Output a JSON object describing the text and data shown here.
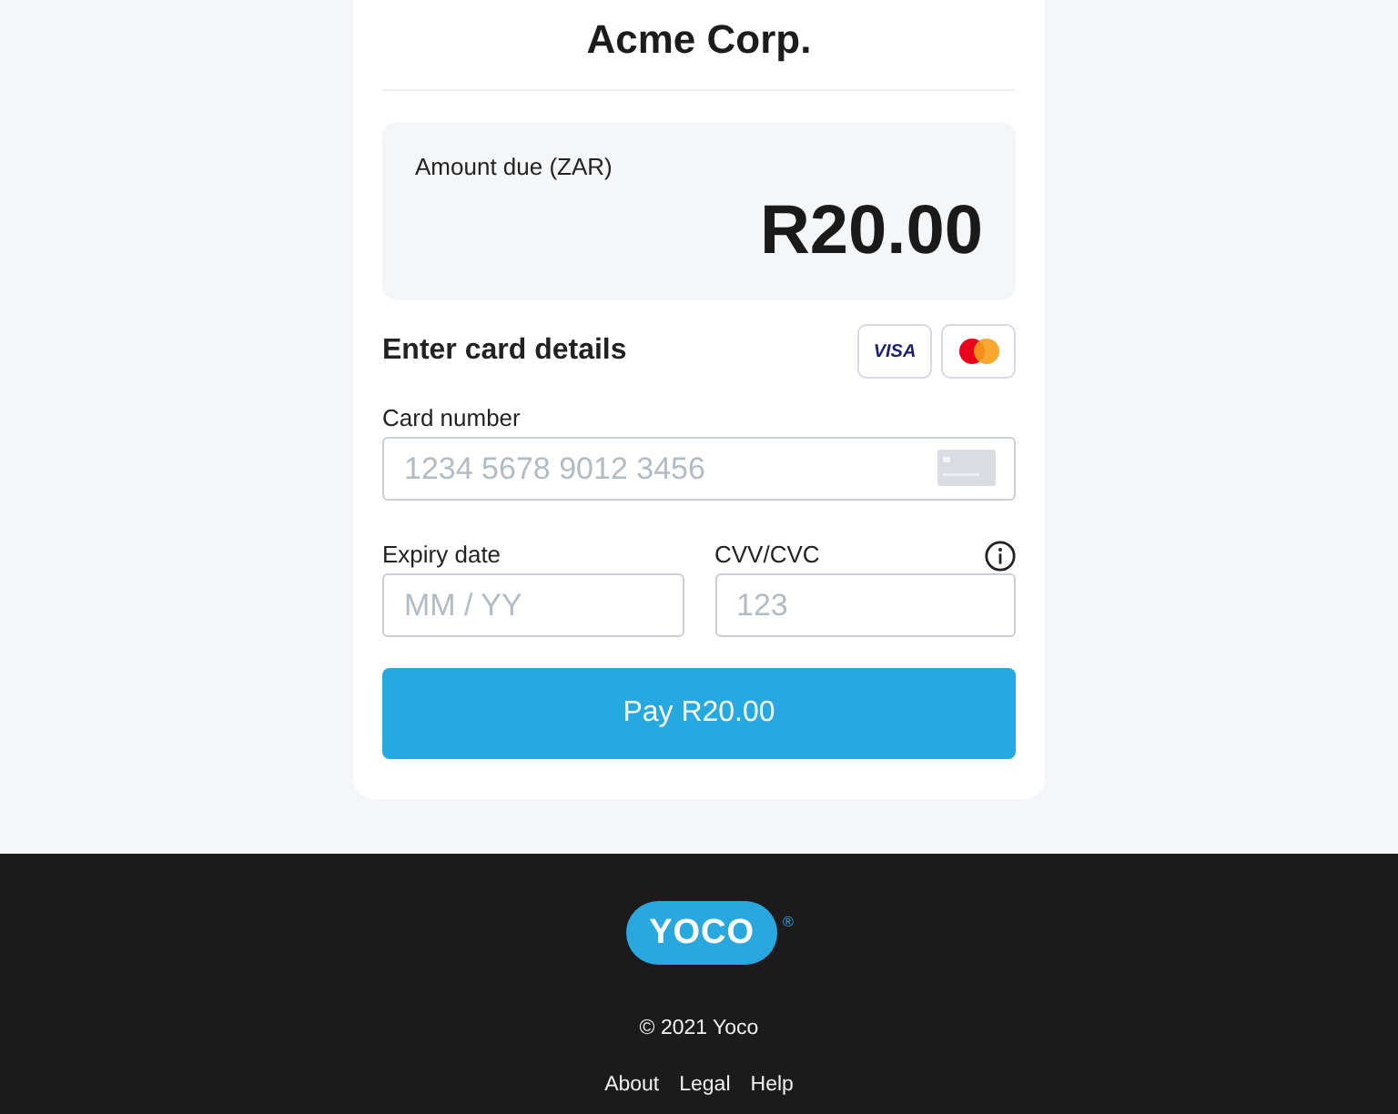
{
  "merchant": {
    "name": "Acme Corp."
  },
  "amount": {
    "label": "Amount due (ZAR)",
    "value": "R20.00"
  },
  "card_form": {
    "heading": "Enter card details",
    "card_brands": [
      {
        "kind": "visa",
        "label": "VISA"
      },
      {
        "kind": "mastercard"
      }
    ],
    "field_rows": [
      [
        {
          "kind": "card",
          "label": "Card number",
          "placeholder": "1234 5678 9012 3456"
        }
      ],
      [
        {
          "kind": "plain",
          "label": "Expiry date",
          "placeholder": "MM / YY"
        },
        {
          "kind": "cvv",
          "label": "CVV/CVC",
          "placeholder": "123"
        }
      ]
    ],
    "pay_button": {
      "label": "Pay R20.00"
    }
  },
  "footer": {
    "logo": "YOCO",
    "registered_mark": "®",
    "copyright": "© 2021 Yoco",
    "links": [
      "About",
      "Legal",
      "Help"
    ]
  }
}
